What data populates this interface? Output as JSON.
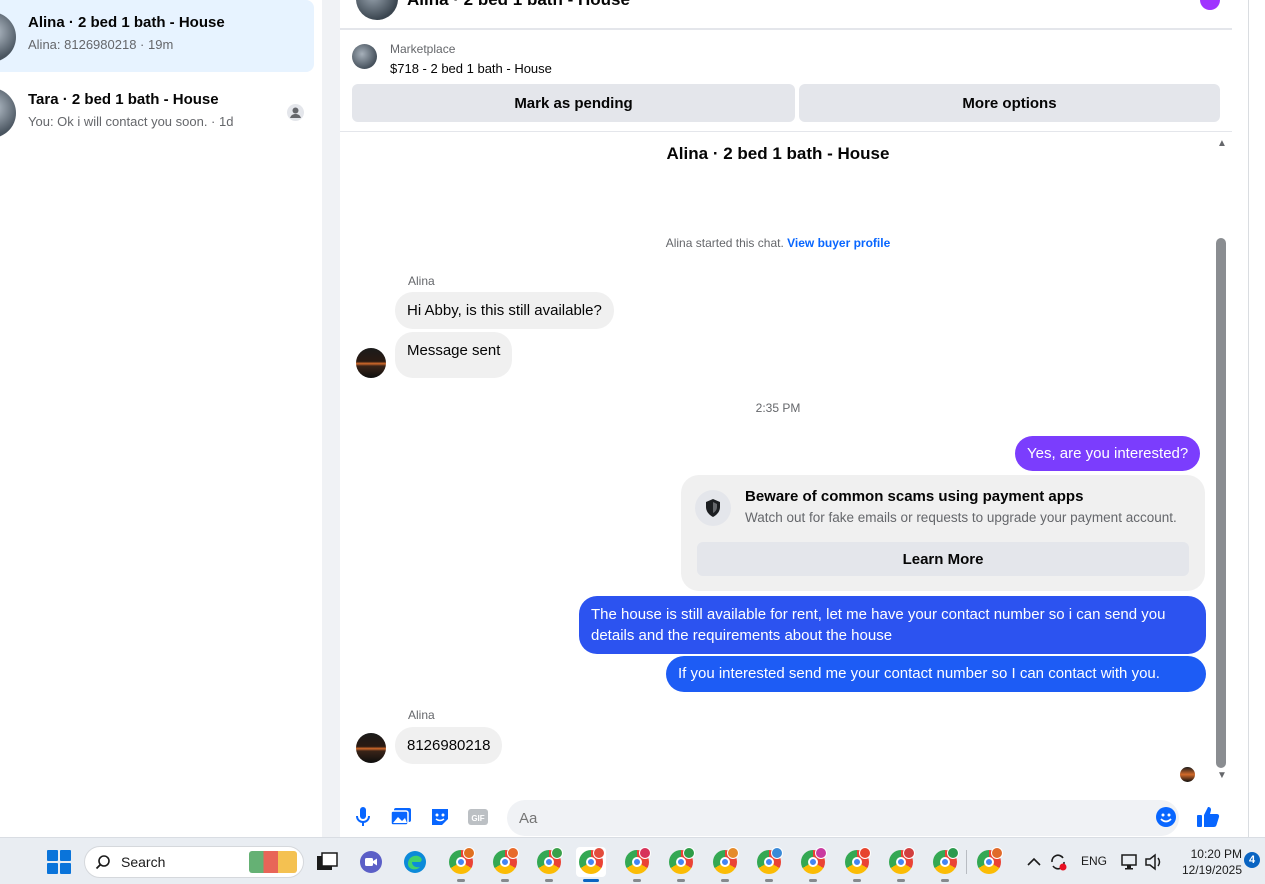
{
  "sidebar": {
    "conversations": [
      {
        "title": "Alina · 2 bed 1 bath - House",
        "preview": "Alina: 8126980218 · 19m"
      },
      {
        "title": "Tara · 2 bed 1 bath - House",
        "preview": "You: Ok i will contact you soon. · 1d"
      }
    ]
  },
  "chat": {
    "header_title": "Alina · 2 bed 1 bath - House",
    "marketplace": {
      "label": "Marketplace",
      "listing": "$718 - 2 bed 1 bath - House",
      "pending_button": "Mark as pending",
      "more_button": "More options"
    },
    "conversation_title": "Alina · 2 bed 1 bath - House",
    "started_text": "Alina started this chat.",
    "buyer_profile_link": "View buyer profile",
    "timestamp": "2:35 PM",
    "messages": {
      "sender1": "Alina",
      "in1": "Hi Abby, is this still available?",
      "in2": "Message sent",
      "out1": "Yes, are you interested?",
      "out2": "The house is still available for rent, let me have your contact number so i can send you details and the requirements about the house",
      "out3": "If you interested send me your contact number so I can contact with you.",
      "sender2": "Alina",
      "in3": "8126980218"
    },
    "warning": {
      "title": "Beware of common scams using payment apps",
      "text": "Watch out for fake emails or requests to upgrade your payment account.",
      "button": "Learn More"
    },
    "composer": {
      "placeholder": "Aa"
    }
  },
  "taskbar": {
    "search_label": "Search",
    "language": "ENG",
    "time": "10:20 PM",
    "date": "12/19/2025",
    "notification_count": "4"
  },
  "colors": {
    "messenger_blue": "#0866ff",
    "gradient_purple": "#7b3dfd",
    "active_conv_bg": "#e7f3ff",
    "incoming_bubble": "#f0f0f0"
  }
}
